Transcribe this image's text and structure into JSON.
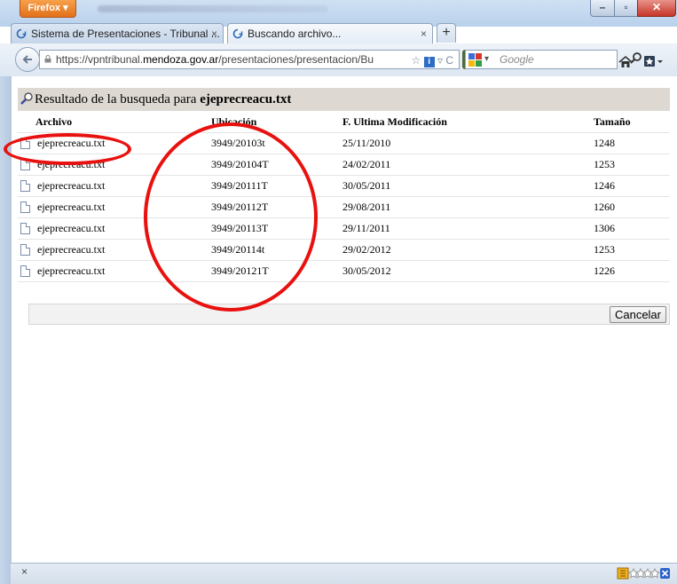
{
  "window": {
    "app_menu_label": "Firefox ▾"
  },
  "tabs": [
    {
      "label": "Sistema de Presentaciones - Tribunal ...",
      "close": "×"
    },
    {
      "label": "Buscando archivo...",
      "close": "×"
    }
  ],
  "new_tab_label": "+",
  "navbar": {
    "url_prefix": "https://vpntribunal.",
    "url_domain": "mendoza.gov.ar",
    "url_suffix": "/presentaciones/presentacion/Bu",
    "search_placeholder": "Google"
  },
  "results": {
    "heading_prefix": "Resultado de la busqueda para ",
    "query": "ejeprecreacu.txt",
    "columns": [
      "Archivo",
      "Ubicación",
      "F. Ultima Modificación",
      "Tamaño"
    ],
    "rows": [
      {
        "file": "ejeprecreacu.txt",
        "location": "3949/20103t",
        "modified": "25/11/2010",
        "size": "1248"
      },
      {
        "file": "ejeprecreacu.txt",
        "location": "3949/20104T",
        "modified": "24/02/2011",
        "size": "1253"
      },
      {
        "file": "ejeprecreacu.txt",
        "location": "3949/20111T",
        "modified": "30/05/2011",
        "size": "1246"
      },
      {
        "file": "ejeprecreacu.txt",
        "location": "3949/20112T",
        "modified": "29/08/2011",
        "size": "1260"
      },
      {
        "file": "ejeprecreacu.txt",
        "location": "3949/20113T",
        "modified": "29/11/2011",
        "size": "1306"
      },
      {
        "file": "ejeprecreacu.txt",
        "location": "3949/20114t",
        "modified": "29/02/2012",
        "size": "1253"
      },
      {
        "file": "ejeprecreacu.txt",
        "location": "3949/20121T",
        "modified": "30/05/2012",
        "size": "1226"
      }
    ],
    "cancel_label": "Cancelar"
  },
  "statusbar": {
    "close_label": "×"
  },
  "colors": {
    "annotation": "#e8110f",
    "heading_bg": "#ddd9d2"
  }
}
